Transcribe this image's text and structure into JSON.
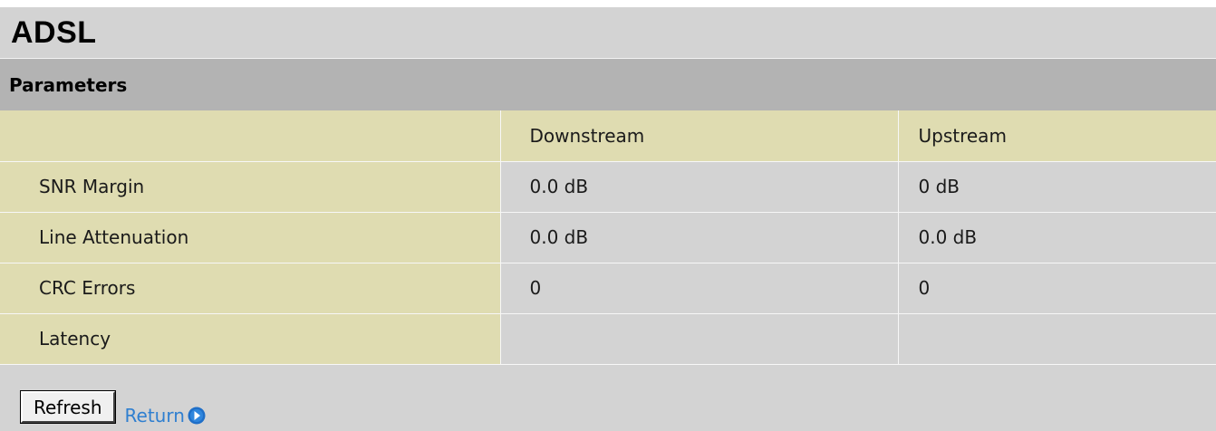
{
  "page": {
    "title": "ADSL",
    "section_title": "Parameters"
  },
  "table": {
    "headers": [
      "",
      "Downstream",
      "Upstream"
    ],
    "rows": [
      {
        "label": "SNR Margin",
        "downstream": "0.0 dB",
        "upstream": "0 dB"
      },
      {
        "label": "Line Attenuation",
        "downstream": "0.0 dB",
        "upstream": "0.0 dB"
      },
      {
        "label": "CRC Errors",
        "downstream": "0",
        "upstream": "0"
      },
      {
        "label": "Latency",
        "downstream": "",
        "upstream": ""
      }
    ]
  },
  "actions": {
    "refresh_label": "Refresh",
    "return_label": "Return",
    "return_icon": "arrow-right-circle-icon"
  },
  "colors": {
    "page_bg": "#d3d3d3",
    "section_bg": "#b3b3b3",
    "label_cell_bg": "#dfdcb1",
    "link": "#2f7fd0"
  }
}
